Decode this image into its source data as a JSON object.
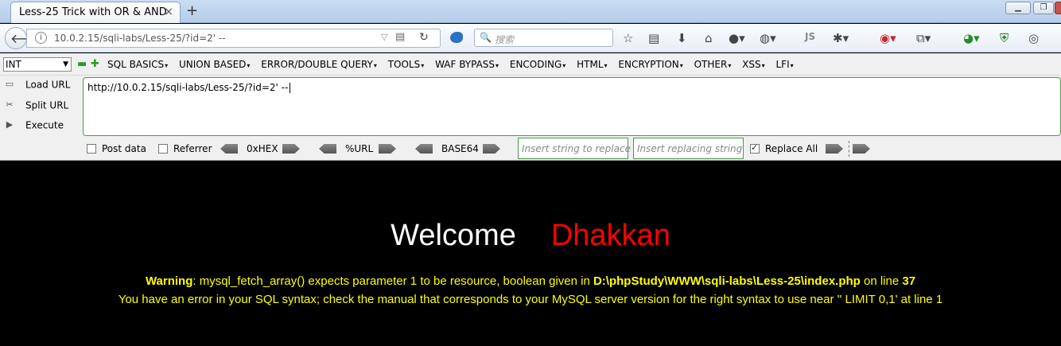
{
  "browser": {
    "tab_title": "Less-25 Trick with OR & AND",
    "tab_close": "×",
    "new_tab": "+",
    "url": "10.0.2.15/sqli-labs/Less-25/?id=2' --",
    "search_placeholder": "搜索"
  },
  "hackbar": {
    "type_select": "INT",
    "menu": [
      "SQL BASICS",
      "UNION BASED",
      "ERROR/DOUBLE QUERY",
      "TOOLS",
      "WAF BYPASS",
      "ENCODING",
      "HTML",
      "ENCRYPTION",
      "OTHER",
      "XSS",
      "LFI"
    ],
    "load_url": "Load URL",
    "split_url": "Split URL",
    "execute": "Execute",
    "url_value": "http://10.0.2.15/sqli-labs/Less-25/?id=2' --",
    "post_data": "Post data",
    "referrer": "Referrer",
    "hex": "0xHEX",
    "percent_url": "%URL",
    "base64": "BASE64",
    "replace_placeholder": "Insert string to replace",
    "replacing_placeholder": "Insert replacing string",
    "replace_all": "Replace All",
    "replace_all_checked": true
  },
  "page": {
    "welcome": "Welcome",
    "name": "Dhakkan",
    "warning_label": "Warning",
    "warning_text": ": mysql_fetch_array() expects parameter 1 to be resource, boolean given in ",
    "warning_path": "D:\\phpStudy\\WWW\\sqli-labs\\Less-25\\index.php",
    "warning_online": " on line ",
    "warning_line_no": "37",
    "error_text": "You have an error in your SQL syntax; check the manual that corresponds to your MySQL server version for the right syntax to use near '' LIMIT 0,1' at line 1"
  },
  "colors": {
    "welcome": "#ffffff",
    "name": "#ff0000",
    "warning": "#ffff00"
  }
}
